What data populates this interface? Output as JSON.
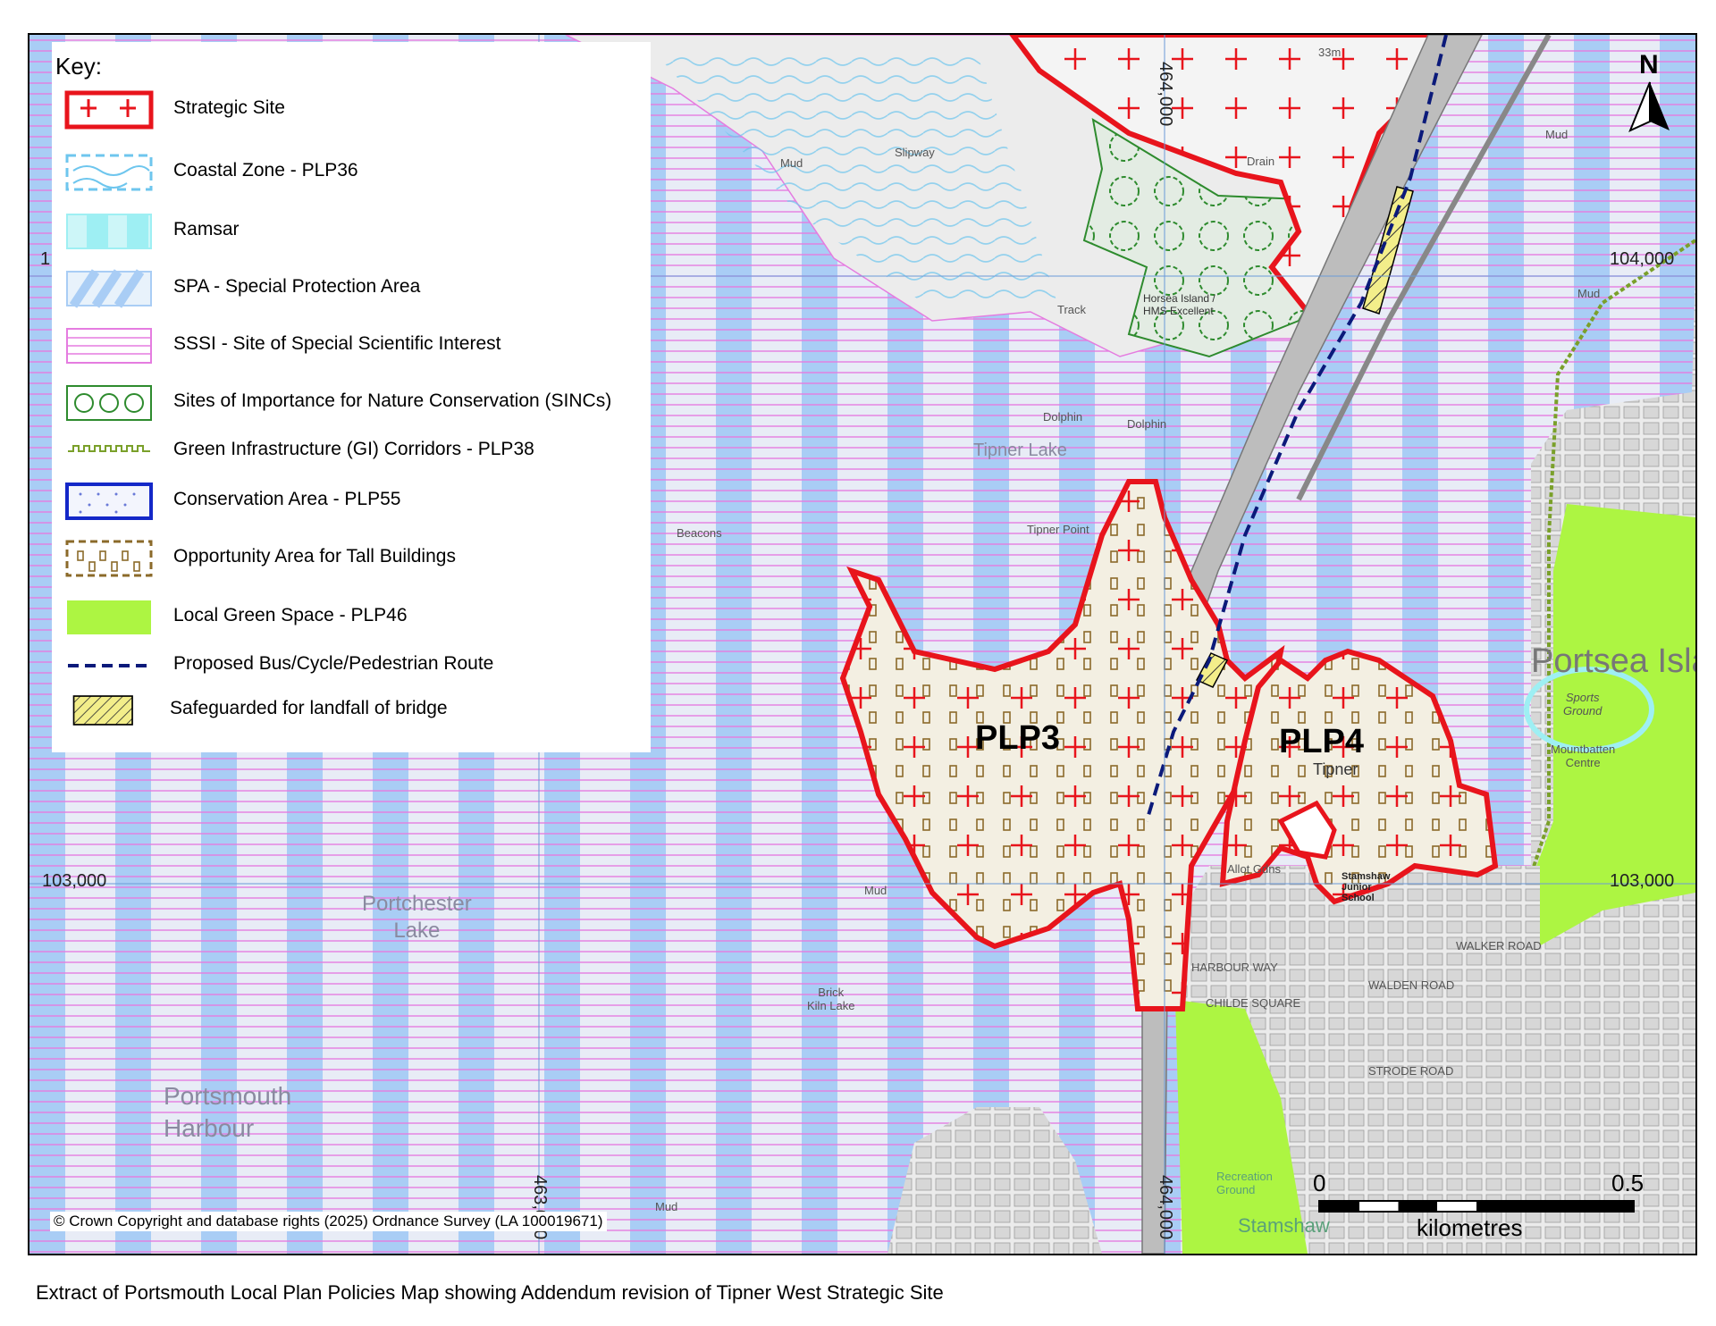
{
  "legend": {
    "title": "Key:",
    "items": [
      {
        "label": "Strategic Site",
        "icon": "strategic-site-symbol"
      },
      {
        "label": "Coastal Zone - PLP36",
        "icon": "coastal-zone-symbol"
      },
      {
        "label": "Ramsar",
        "icon": "ramsar-symbol"
      },
      {
        "label": "SPA - Special Protection Area",
        "icon": "spa-symbol"
      },
      {
        "label": "SSSI - Site of Special Scientific Interest",
        "icon": "sssi-symbol"
      },
      {
        "label": "Sites of Importance for Nature Conservation (SINCs)",
        "icon": "sinc-symbol"
      },
      {
        "label": "Green Infrastructure (GI) Corridors - PLP38",
        "icon": "gi-corridor-symbol"
      },
      {
        "label": "Conservation Area - PLP55",
        "icon": "conservation-area-symbol"
      },
      {
        "label": "Opportunity Area for Tall Buildings",
        "icon": "tall-buildings-symbol"
      },
      {
        "label": "Local Green Space - PLP46",
        "icon": "local-green-space-symbol"
      },
      {
        "label": "Proposed Bus/Cycle/Pedestrian Route",
        "icon": "bus-route-symbol"
      },
      {
        "label": "Safeguarded for landfall of bridge",
        "icon": "bridge-landfall-symbol"
      }
    ]
  },
  "map": {
    "sites": {
      "plp3": "PLP3",
      "plp4": "PLP4"
    },
    "grid": {
      "northing_top_right": "104,000",
      "northing_bottom_left": "103,000",
      "northing_bottom_right": "103,000",
      "easting_top": "464,000",
      "easting_bottom": "464,000",
      "easting_bottom_left": "463,000",
      "northing_partial_left": "1"
    },
    "places": {
      "tipner_lake": "Tipner Lake",
      "portchester_lake": "Portchester\nLake",
      "portsmouth_harbour": "Portsmouth\nHarbour",
      "portsea_island": "Portsea Isla",
      "stamshaw": "Stamshaw",
      "tipner": "Tipner",
      "horsea_island": "Horsea Island /\nHMS Excellent",
      "tipner_point": "Tipner Point",
      "stamshaw_junior_school": "Stamshaw\nJunior\nSchool",
      "mountbatten_centre": "Mountbatten\nCentre",
      "sports_ground": "Sports\nGround",
      "recreation_ground": "Recreation\nGround",
      "allot_gdns": "Allot Gdns",
      "brick_kiln_lake": "Brick\nKiln Lake",
      "harbour_way": "HARBOUR WAY",
      "walden_road": "WALDEN ROAD",
      "strode_road": "STRODE ROAD",
      "walker_road": "WALKER ROAD",
      "childe_square": "CHILDE SQUARE",
      "mud_1": "Mud",
      "mud_2": "Mud",
      "mud_3": "Mud",
      "mud_4": "Mud",
      "mud_5": "Mud",
      "dolphin_1": "Dolphin",
      "dolphin_2": "Dolphin",
      "beacons": "Beacons",
      "slipway": "Slipway",
      "drain": "Drain",
      "track": "Track",
      "height": "33m"
    },
    "north_arrow": "N",
    "scale": {
      "start": "0",
      "end": "0.5",
      "unit": "kilometres"
    },
    "copyright": "© Crown Copyright and database rights (2025) Ordnance Survey (LA 100019671)"
  },
  "caption": "Extract of Portsmouth Local Plan Policies Map showing Addendum revision of Tipner West Strategic Site",
  "colors": {
    "strategic_site": "#e8141c",
    "spa_blue": "#a9cdf5",
    "sssi_pink": "#e57ce0",
    "coastal_zone": "#6ec6ee",
    "sinc_green": "#2e8b2e",
    "gi_corridor": "#7aa02a",
    "local_green_space": "#adf542",
    "tall_buildings": "#8b6a2a",
    "bus_route": "#0b1a7a",
    "bridge_hatch": "#f3ee8a"
  }
}
